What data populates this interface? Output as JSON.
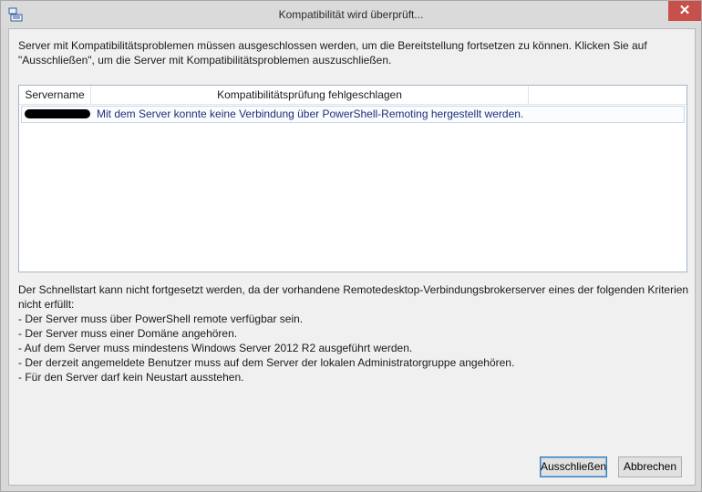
{
  "window": {
    "title": "Kompatibilität wird überprüft...",
    "close_symbol": "✕",
    "app_icon": "server-manager-icon"
  },
  "intro_text": "Server mit Kompatibilitätsproblemen müssen ausgeschlossen werden, um die Bereitstellung fortsetzen zu können. Klicken Sie auf \"Ausschließen\", um die Server mit Kompatibilitätsproblemen auszuschließen.",
  "list": {
    "columns": [
      "Servername",
      "Kompatibilitätsprüfung fehlgeschlagen"
    ],
    "rows": [
      {
        "message": "Mit dem Server konnte keine Verbindung über PowerShell-Remoting hergestellt werden."
      }
    ]
  },
  "details": {
    "lead": "Der Schnellstart kann nicht fortgesetzt werden, da der vorhandene Remotedesktop-Verbindungsbrokerserver eines der folgenden Kriterien nicht erfüllt:",
    "criteria": [
      "- Der Server muss über PowerShell remote verfügbar sein.",
      "- Der Server muss einer Domäne angehören.",
      "- Auf dem Server muss mindestens Windows Server 2012 R2 ausgeführt werden.",
      "- Der derzeit angemeldete Benutzer muss auf dem Server der lokalen Administratorgruppe angehören.",
      "- Für den Server darf kein Neustart ausstehen."
    ]
  },
  "buttons": {
    "exclude_label": "Ausschließen",
    "cancel_label": "Abbrechen"
  }
}
